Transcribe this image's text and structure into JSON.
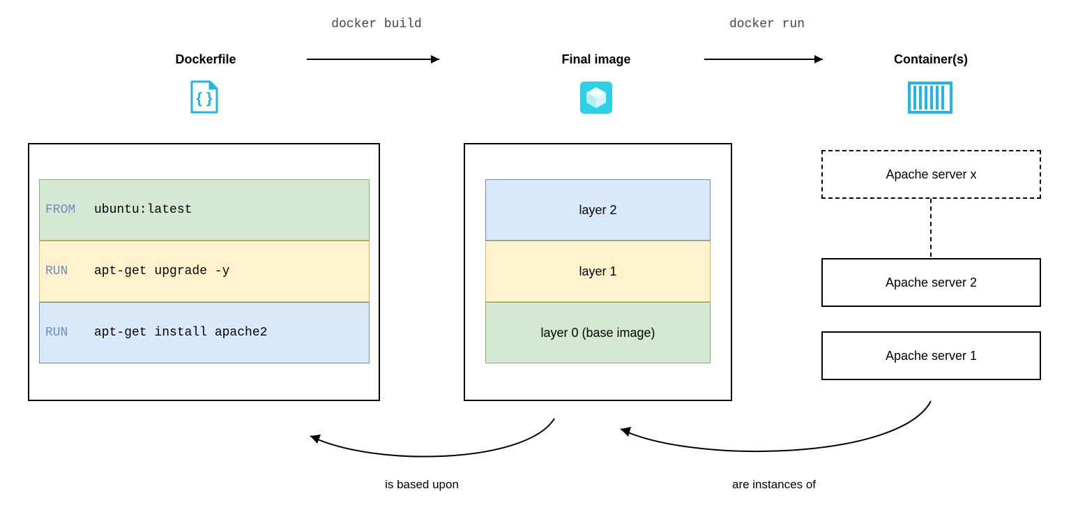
{
  "headers": {
    "dockerfile": "Dockerfile",
    "image": "Final image",
    "containers": "Container(s)"
  },
  "commands": {
    "build": "docker build",
    "run": "docker run"
  },
  "dockerfile": {
    "line0_key": "FROM",
    "line0_val": "ubuntu:latest",
    "line1_key": "RUN",
    "line1_val": "apt-get upgrade -y",
    "line2_key": "RUN",
    "line2_val": "apt-get install apache2"
  },
  "layers": {
    "l2": "layer 2",
    "l1": "layer 1",
    "l0": "layer 0 (base image)"
  },
  "servers": {
    "sx": "Apache server x",
    "s2": "Apache server 2",
    "s1": "Apache server 1"
  },
  "captions": {
    "based": "is based upon",
    "instances": "are instances of"
  }
}
